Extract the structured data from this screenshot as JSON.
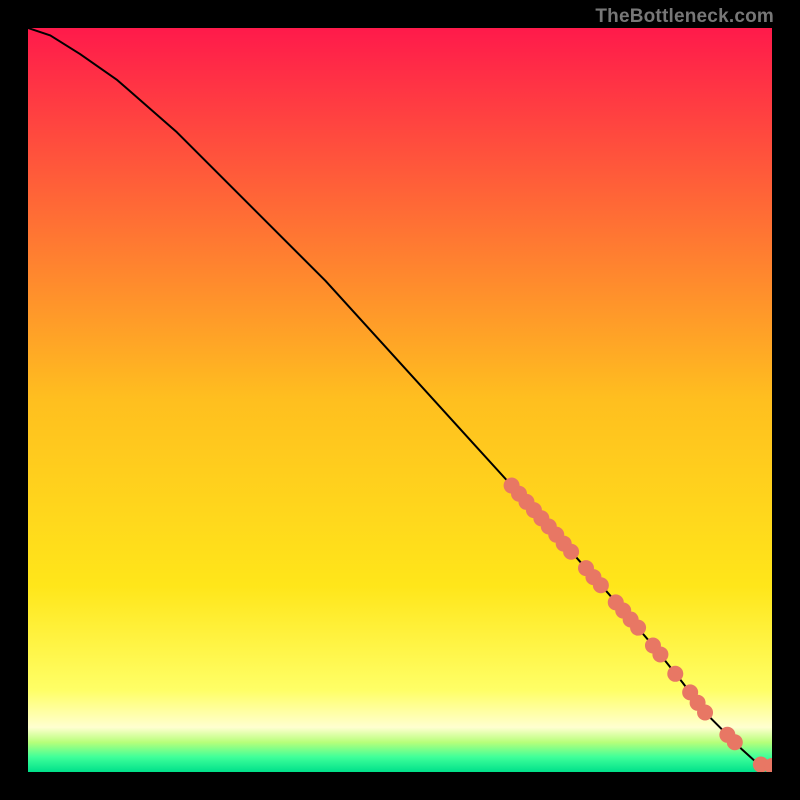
{
  "watermark": "TheBottleneck.com",
  "chart_data": {
    "type": "line",
    "title": "",
    "xlabel": "",
    "ylabel": "",
    "xlim": [
      0,
      100
    ],
    "ylim": [
      0,
      100
    ],
    "grid": false,
    "legend": false,
    "background_gradient": {
      "stops": [
        {
          "pos": 0.0,
          "color": "#ff1a4b"
        },
        {
          "pos": 0.5,
          "color": "#ffbf1f"
        },
        {
          "pos": 0.75,
          "color": "#ffe61a"
        },
        {
          "pos": 0.89,
          "color": "#ffff66"
        },
        {
          "pos": 0.94,
          "color": "#ffffd0"
        },
        {
          "pos": 0.96,
          "color": "#b7ff7a"
        },
        {
          "pos": 0.98,
          "color": "#3fff9a"
        },
        {
          "pos": 1.0,
          "color": "#00e08a"
        }
      ]
    },
    "series": [
      {
        "name": "curve",
        "color": "#000000",
        "x": [
          0,
          3,
          7,
          12,
          20,
          30,
          40,
          50,
          60,
          70,
          78,
          84,
          88,
          91,
          94,
          96,
          98,
          100
        ],
        "y": [
          100,
          99,
          96.5,
          93,
          86,
          76,
          66,
          55,
          44,
          33,
          24,
          17,
          12,
          8,
          5,
          3,
          1.2,
          0.8
        ]
      }
    ],
    "markers": {
      "name": "highlight-dots",
      "color": "#e87764",
      "radius": 8,
      "points": [
        {
          "x": 65,
          "y": 38.5
        },
        {
          "x": 66,
          "y": 37.4
        },
        {
          "x": 67,
          "y": 36.3
        },
        {
          "x": 68,
          "y": 35.2
        },
        {
          "x": 69,
          "y": 34.1
        },
        {
          "x": 70,
          "y": 33.0
        },
        {
          "x": 71,
          "y": 31.9
        },
        {
          "x": 72,
          "y": 30.7
        },
        {
          "x": 73,
          "y": 29.6
        },
        {
          "x": 75,
          "y": 27.4
        },
        {
          "x": 76,
          "y": 26.2
        },
        {
          "x": 77,
          "y": 25.1
        },
        {
          "x": 79,
          "y": 22.8
        },
        {
          "x": 80,
          "y": 21.7
        },
        {
          "x": 81,
          "y": 20.5
        },
        {
          "x": 82,
          "y": 19.4
        },
        {
          "x": 84,
          "y": 17.0
        },
        {
          "x": 85,
          "y": 15.8
        },
        {
          "x": 87,
          "y": 13.2
        },
        {
          "x": 89,
          "y": 10.7
        },
        {
          "x": 90,
          "y": 9.3
        },
        {
          "x": 91,
          "y": 8.0
        },
        {
          "x": 94,
          "y": 5.0
        },
        {
          "x": 95,
          "y": 4.0
        },
        {
          "x": 98.5,
          "y": 1.0
        },
        {
          "x": 100,
          "y": 0.8
        }
      ]
    }
  }
}
